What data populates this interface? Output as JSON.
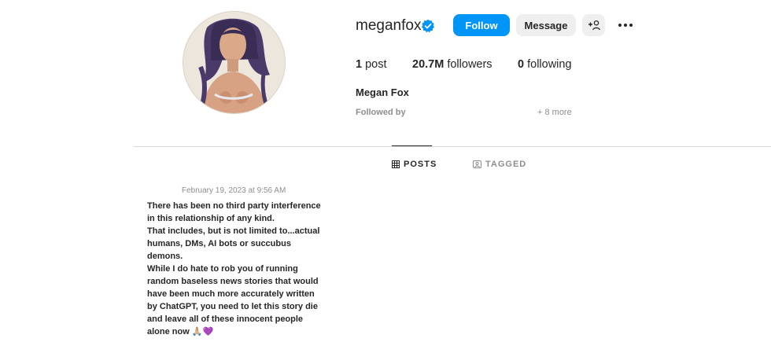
{
  "profile": {
    "username": "meganfox",
    "full_name": "Megan Fox",
    "followed_by_label": "Followed by",
    "more_mutual": "+ 8 more"
  },
  "actions": {
    "follow_label": "Follow",
    "message_label": "Message",
    "add_user_label": "+👤",
    "more_label": "•••"
  },
  "stats": {
    "posts_count": "1",
    "posts_label": "post",
    "followers_count": "20.7M",
    "followers_label": "followers",
    "following_count": "0",
    "following_label": "following"
  },
  "tabs": [
    {
      "label": "POSTS",
      "icon": "grid-icon",
      "active": true
    },
    {
      "label": "TAGGED",
      "icon": "tag-user-icon",
      "active": false
    }
  ],
  "post": {
    "date": "February 19, 2023 at 9:56 AM",
    "text": "There has been no third party interference\nin this relationship of any kind.\nThat includes, but is not limited to...actual\nhumans, DMs, AI bots or succubus\ndemons.\nWhile I do hate to rob you of running\nrandom baseless news stories that would\nhave been much more accurately written\nby ChatGPT, you need to let this story die\nand leave all of these innocent people\nalone now 🙏🏼💜"
  },
  "colors": {
    "accent": "#0095f6",
    "secondary_button": "#efefef",
    "muted_text": "#8e8e8e",
    "divider": "#dbdbdb",
    "verified": "#0095f6"
  }
}
